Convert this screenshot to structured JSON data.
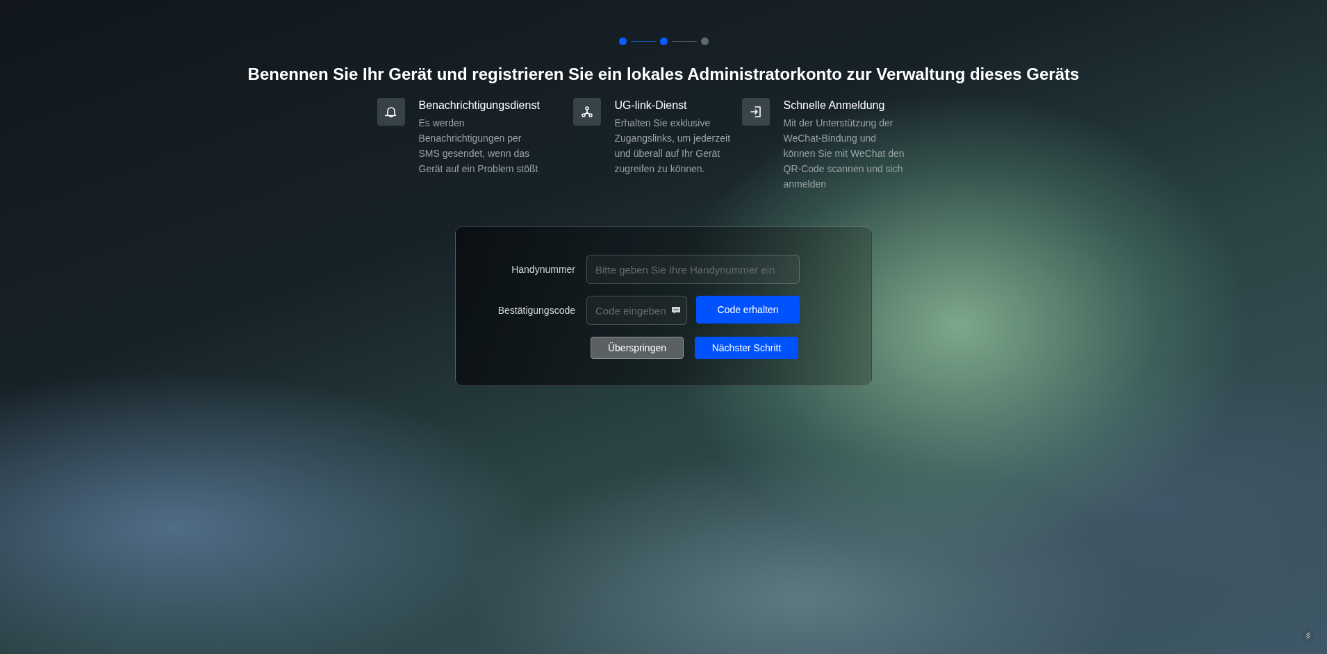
{
  "steps": [
    {
      "active": true
    },
    {
      "active": true
    },
    {
      "active": false
    }
  ],
  "title": "Benennen Sie Ihr Gerät und registrieren Sie ein lokales Administratorkonto zur Verwaltung dieses Geräts",
  "features": [
    {
      "kind": "bell",
      "title": "Benachrichtigungsdienst",
      "text": "Es werden Benachrichtigungen per SMS gesendet, wenn das Gerät auf ein Problem stößt"
    },
    {
      "kind": "link",
      "title": "UG-link-Dienst",
      "text": "Erhalten Sie exklusive Zugangslinks, um jederzeit und überall auf Ihr Gerät zugreifen zu können."
    },
    {
      "kind": "login",
      "title": "Schnelle Anmeldung",
      "text": "Mit der Unterstützung der WeChat-Bindung und können Sie mit WeChat den QR-Code scannen und sich anmelden"
    }
  ],
  "form": {
    "phone": {
      "label": "Handynummer",
      "placeholder": "Bitte geben Sie Ihre Handynummer ein"
    },
    "code": {
      "label": "Bestätigungscode",
      "placeholder": "Code eingeben"
    },
    "get_code_button": "Code erhalten",
    "skip_button": "Überspringen",
    "next_button": "Nächster Schritt"
  }
}
